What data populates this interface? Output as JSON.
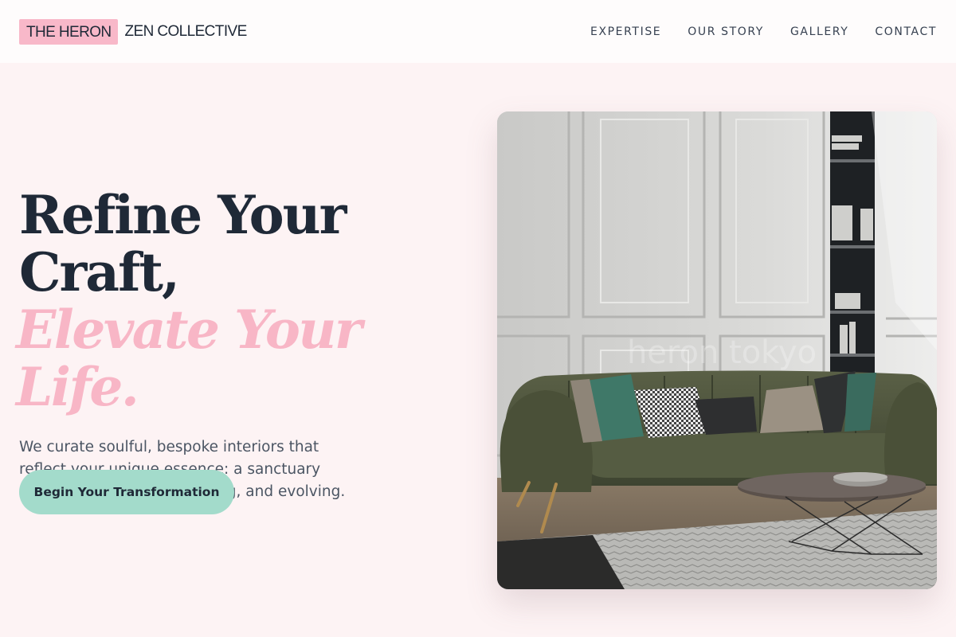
{
  "brand": {
    "mark": "THE HERON",
    "name": "ZEN COLLECTIVE"
  },
  "nav": {
    "items": [
      {
        "label": "EXPERTISE"
      },
      {
        "label": "OUR STORY"
      },
      {
        "label": "GALLERY"
      },
      {
        "label": "CONTACT"
      }
    ]
  },
  "hero": {
    "headline_line1": "Refine Your",
    "headline_line2": "Craft,",
    "headline_accent": "Elevate Your Life.",
    "lede": "We curate soulful, bespoke interiors that reflect your unique essence: a sanctuary designed for living, breathing, and evolving.",
    "cta_label": "Begin Your Transformation",
    "image_watermark": "heron tokyo"
  },
  "colors": {
    "accent_pink": "#f8b8c9",
    "accent_mint": "#a3dbcb",
    "background": "#fdf3f4",
    "ink": "#1f2937"
  }
}
